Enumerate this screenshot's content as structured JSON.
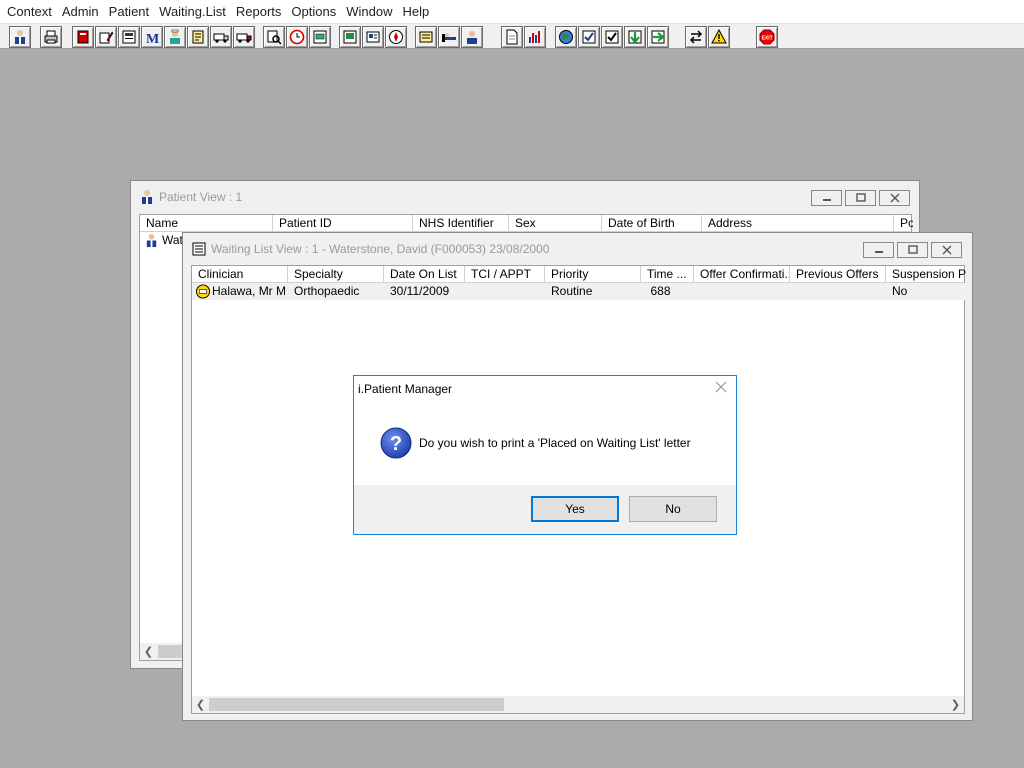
{
  "menu": [
    "Context",
    "Admin",
    "Patient",
    "Waiting.List",
    "Reports",
    "Options",
    "Window",
    "Help"
  ],
  "toolbar_icons": [
    "doctor-icon",
    "print-icon",
    "book-icon",
    "edit-pencil-icon",
    "form-icon",
    "m-letter-icon",
    "nurse-icon",
    "notepad-icon",
    "ambulance-icon",
    "ambulance-2-icon",
    "search-doc-icon",
    "clock-icon",
    "list-icon",
    "photo-icon",
    "card-icon",
    "compass-icon",
    "note-icon",
    "bed-icon",
    "user-group-icon",
    "document-icon",
    "bar-chart-icon",
    "globe-icon",
    "check-list-icon",
    "check-list-2-icon",
    "green-arrow-down-icon",
    "green-arrow-right-icon",
    "transfer-icon",
    "warning-icon",
    "exit-icon"
  ],
  "patient_view": {
    "title": "Patient View : 1",
    "columns": [
      "Name",
      "Patient ID",
      "NHS Identifier",
      "Sex",
      "Date of Birth",
      "Address",
      "Po"
    ],
    "row_name": "Wate"
  },
  "waiting_list_view": {
    "title": "Waiting List View :  1 - Waterstone, David (F000053) 23/08/2000",
    "columns": [
      "Clinician",
      "Specialty",
      "Date On List",
      "TCI / APPT",
      "Priority",
      "Time ...",
      "Offer Confirmati...",
      "Previous Offers",
      "Suspension Pe"
    ],
    "rows": [
      {
        "clinician": "Halawa, Mr M",
        "specialty": "Orthopaedic",
        "date_on_list": "30/11/2009",
        "tci_appt": "",
        "priority": "Routine",
        "time": "688",
        "offer_confirmation": "",
        "previous_offers": "",
        "suspension": "No"
      }
    ]
  },
  "dialog": {
    "title": "i.Patient Manager",
    "message": "Do you wish to print  a 'Placed on Waiting List' letter",
    "yes_label": "Yes",
    "no_label": "No"
  },
  "colors": {
    "desktop": "#ababab",
    "dialog_border": "#1883d7",
    "inactive_title_text": "#9a9a9a"
  }
}
